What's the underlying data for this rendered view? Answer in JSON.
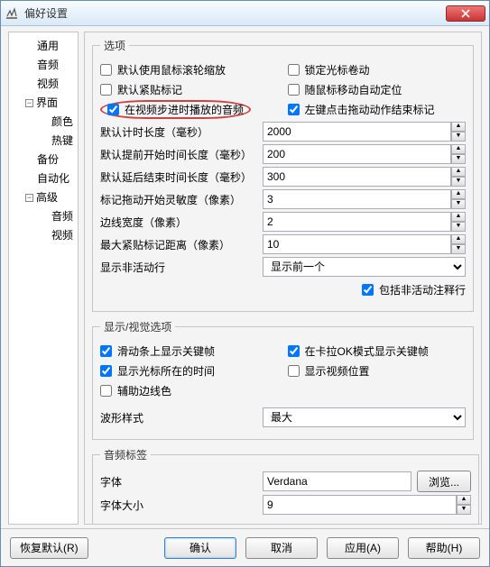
{
  "window": {
    "title": "偏好设置"
  },
  "tree": {
    "general": "通用",
    "audio": "音频",
    "video": "视频",
    "interface": "界面",
    "color": "颜色",
    "hotkey": "热键",
    "backup": "备份",
    "automation": "自动化",
    "advanced": "高级",
    "adv_audio": "音频",
    "adv_video": "视频"
  },
  "options": {
    "legend": "选项",
    "chk": {
      "mouse_wheel_zoom": "默认使用鼠标滚轮缩放",
      "lock_cursor_scroll": "锁定光标卷动",
      "default_snap_marker": "默认紧贴标记",
      "mouse_move_auto_locate": "随鼠标移动自动定位",
      "play_audio_on_step": "在视频步进时播放的音频",
      "left_click_drag_end_mark": "左键点击拖动动作结束标记"
    },
    "checked": {
      "mouse_wheel_zoom": false,
      "lock_cursor_scroll": false,
      "default_snap_marker": false,
      "mouse_move_auto_locate": false,
      "play_audio_on_step": true,
      "left_click_drag_end_mark": true
    },
    "fields": {
      "default_timer_ms": "默认计时长度（毫秒）",
      "default_lead_in_ms": "默认提前开始时间长度（毫秒）",
      "default_lead_out_ms": "默认延后结束时间长度（毫秒）",
      "drag_start_sensitivity_px": "标记拖动开始灵敏度（像素）",
      "edge_width_px": "边线宽度（像素）",
      "max_snap_distance_px": "最大紧贴标记距离（像素）",
      "show_inactive_lines": "显示非活动行",
      "include_inactive_comment": "包括非活动注释行"
    },
    "values": {
      "default_timer_ms": "2000",
      "default_lead_in_ms": "200",
      "default_lead_out_ms": "300",
      "drag_start_sensitivity_px": "3",
      "edge_width_px": "2",
      "max_snap_distance_px": "10"
    },
    "inactive_opts": {
      "selected": "显示前一个"
    },
    "include_inactive_comment_checked": true
  },
  "display": {
    "legend": "显示/视觉选项",
    "chk": {
      "show_keyframes_on_slider": "滑动条上显示关键帧",
      "karaoke_show_keyframes": "在卡拉OK模式显示关键帧",
      "show_cursor_time": "显示光标所在的时间",
      "show_video_position": "显示视频位置",
      "aux_guide_color": "辅助边线色"
    },
    "checked": {
      "show_keyframes_on_slider": true,
      "karaoke_show_keyframes": true,
      "show_cursor_time": true,
      "show_video_position": false,
      "aux_guide_color": false
    },
    "waveform_label": "波形样式",
    "waveform_selected": "最大"
  },
  "audiotag": {
    "legend": "音频标签",
    "font_label": "字体",
    "font_value": "Verdana",
    "browse": "浏览...",
    "size_label": "字体大小",
    "size_value": "9"
  },
  "footer": {
    "restore": "恢复默认(R)",
    "ok": "确认",
    "cancel": "取消",
    "apply": "应用(A)",
    "help": "帮助(H)"
  }
}
